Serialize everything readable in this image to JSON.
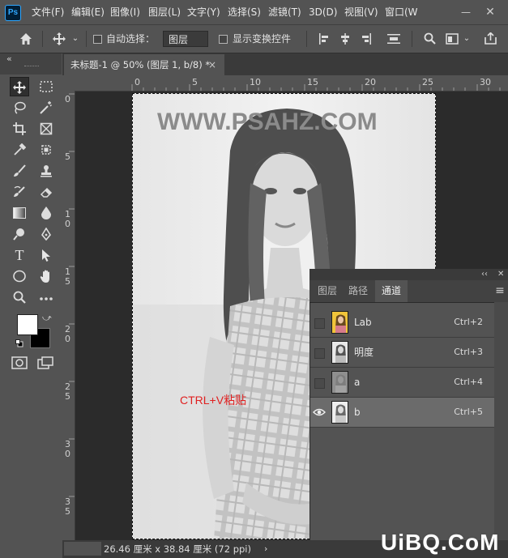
{
  "app": {
    "logo": "Ps"
  },
  "menu": [
    "文件(F)",
    "编辑(E)",
    "图像(I)",
    "图层(L)",
    "文字(Y)",
    "选择(S)",
    "滤镜(T)",
    "3D(D)",
    "视图(V)",
    "窗口(W"
  ],
  "window": {
    "minimize": "—",
    "close": "✕"
  },
  "options": {
    "auto_select_label": "自动选择：",
    "auto_select_value": "图层",
    "show_transform_label": "显示变换控件"
  },
  "panel_collapse": "«",
  "document": {
    "tab_title": "未标题-1 @ 50% (图层 1, b/8) *",
    "close": "×"
  },
  "ruler_top": [
    "0",
    "5",
    "10",
    "15",
    "20",
    "25",
    "30"
  ],
  "ruler_left": [
    [
      "0"
    ],
    [
      "5"
    ],
    [
      "1",
      "0"
    ],
    [
      "1",
      "5"
    ],
    [
      "2",
      "0"
    ],
    [
      "2",
      "5"
    ],
    [
      "3",
      "0"
    ],
    [
      "3",
      "5"
    ]
  ],
  "canvas": {
    "watermark": "WWW.PSAHZ.COM",
    "annotation": "CTRL+V粘贴"
  },
  "status": {
    "text": "26.46 厘米 x 38.84 厘米 (72 ppi)",
    "arrow": "›"
  },
  "site_watermark": "UiBQ.CoM",
  "panel": {
    "collapse": "‹‹",
    "close": "✕",
    "menu": "≡",
    "tabs": [
      "图层",
      "路径",
      "通道"
    ],
    "active_tab": 2,
    "channels": [
      {
        "name": "Lab",
        "shortcut": "Ctrl+2",
        "visible": false,
        "selected": false
      },
      {
        "name": "明度",
        "shortcut": "Ctrl+3",
        "visible": false,
        "selected": false
      },
      {
        "name": "a",
        "shortcut": "Ctrl+4",
        "visible": false,
        "selected": false
      },
      {
        "name": "b",
        "shortcut": "Ctrl+5",
        "visible": true,
        "selected": true
      }
    ]
  },
  "colors": {
    "foreground": "#ffffff",
    "background": "#000000",
    "annotation": "#e02020"
  }
}
